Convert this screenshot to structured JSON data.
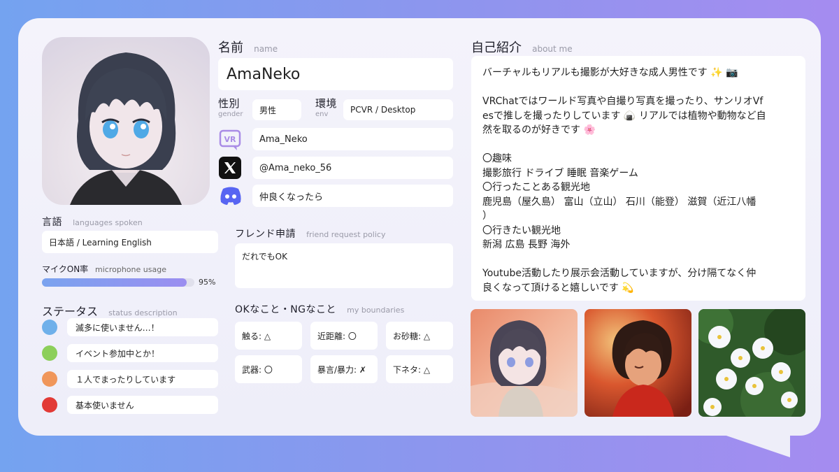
{
  "profile": {
    "name_label": "名前",
    "name_label_en": "name",
    "name": "AmaNeko",
    "gender_label": "性別",
    "gender_label_en": "gender",
    "gender": "男性",
    "env_label": "環境",
    "env_label_en": "env",
    "env": "PCVR / Desktop",
    "vrchat_handle": "Ama_Neko",
    "x_handle": "@Ama_neko_56",
    "discord_text": "仲良くなったら",
    "vr_icon_text": "VR"
  },
  "languages": {
    "label": "言語",
    "label_en": "languages spoken",
    "value": "日本語 / Learning English"
  },
  "mic": {
    "label": "マイクON率",
    "label_en": "microphone usage",
    "percent_text": "95%",
    "fraction": 0.95
  },
  "status": {
    "label": "ステータス",
    "label_en": "status description",
    "items": [
      {
        "color": "#6fb0ea",
        "text": "滅多に使いません…！"
      },
      {
        "color": "#8ccf5a",
        "text": "イベント参加中とか！"
      },
      {
        "color": "#f0965a",
        "text": "１人でまったりしています"
      },
      {
        "color": "#e23a36",
        "text": "基本使いません"
      }
    ]
  },
  "friend": {
    "label": "フレンド申請",
    "label_en": "friend request policy",
    "value": "だれでもOK"
  },
  "boundaries": {
    "label": "OKなこと・NGなこと",
    "label_en": "my boundaries",
    "items": [
      "触る: △",
      "近距離: 〇",
      "お砂糖: △",
      "武器: 〇",
      "暴言/暴力: ✗",
      "下ネタ: △"
    ]
  },
  "about": {
    "label": "自己紹介",
    "label_en": "about me",
    "lines": [
      "バーチャルもリアルも撮影が大好きな成人男性です ✨ 📷",
      "",
      "VRChatではワールド写真や自撮り写真を撮ったり、サンリオVf",
      "esで推しを撮ったりしています 🍙 リアルでは植物や動物など自",
      "然を取るのが好きです 🌸",
      "",
      "〇趣味",
      "撮影旅行 ドライブ 睡眠 音楽ゲーム",
      "〇行ったことある観光地",
      "鹿児島（屋久島） 富山（立山） 石川（能登） 滋賀（近江八幡",
      "）",
      "〇行きたい観光地",
      "新潟 広島 長野 海外",
      "",
      "Youtube活動したり展示会活動していますが、分け隔てなく仲",
      "良くなって頂けると嬉しいです 💫"
    ]
  },
  "colors": {
    "accent": "#8f95ee",
    "discord": "#5865f2",
    "vr_icon": "#a98ce6"
  }
}
